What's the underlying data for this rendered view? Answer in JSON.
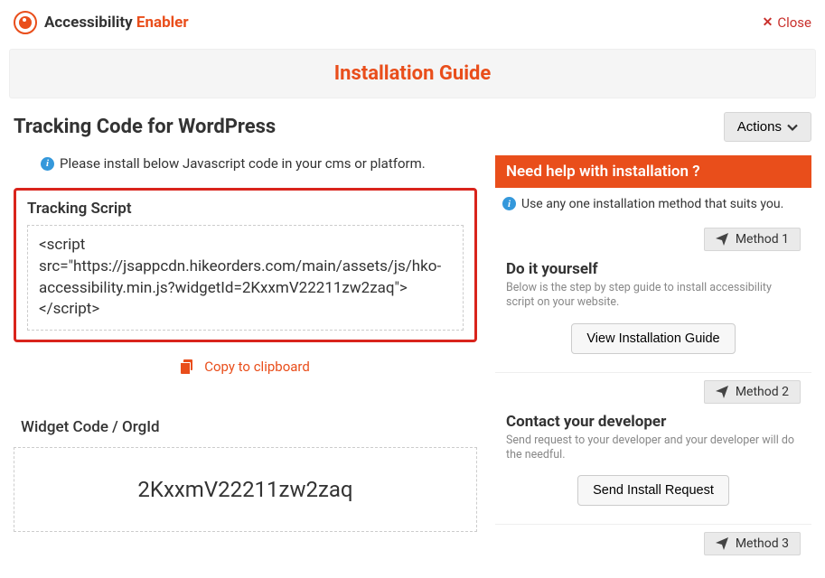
{
  "brand": {
    "name1": "Accessibility",
    "name2": "Enabler"
  },
  "close_label": "Close",
  "page_title": "Installation Guide",
  "sub_title": "Tracking Code for WordPress",
  "actions_label": "Actions",
  "left": {
    "info_text": "Please install below Javascript code in your cms or platform.",
    "tracking_script_title": "Tracking Script",
    "tracking_script": "<script src=\"https://jsappcdn.hikeorders.com/main/assets/js/hko-accessibility.min.js?widgetId=2KxxmV22211zw2zaq\"></script>",
    "copy_label": "Copy to clipboard",
    "widget_label": "Widget Code / OrgId",
    "widget_code": "2KxxmV22211zw2zaq"
  },
  "right": {
    "help_header": "Need help with installation ?",
    "help_info": "Use any one installation method that suits you.",
    "methods": [
      {
        "badge": "Method 1",
        "title": "Do it yourself",
        "desc": "Below is the step by step guide to install accessibility script on your website.",
        "button": "View Installation Guide"
      },
      {
        "badge": "Method 2",
        "title": "Contact your developer",
        "desc": "Send request to your developer and your developer will do the needful.",
        "button": "Send Install Request"
      },
      {
        "badge": "Method 3"
      }
    ]
  }
}
